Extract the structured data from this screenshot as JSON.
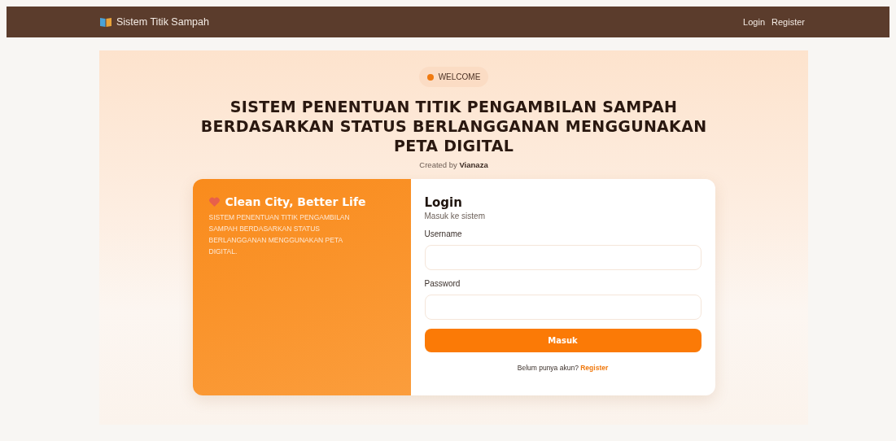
{
  "navbar": {
    "brand": "Sistem Titik Sampah",
    "links": [
      "Login",
      "Register"
    ]
  },
  "hero": {
    "badge": "WELCOME",
    "title": "SISTEM PENENTUAN TITIK PENGAMBILAN SAMPAH BERDASARKAN STATUS BERLANGGANAN MENGGUNAKAN PETA DIGITAL",
    "credit": "Created by **Vianaza**"
  },
  "promo": {
    "heading": "Clean City, Better Life",
    "text": "SISTEM PENENTUAN TITIK PENGAMBILAN SAMPAH BERDASARKAN STATUS BERLANGGANAN MENGGUNAKAN PETA DIGITAL."
  },
  "login": {
    "title": "Login",
    "subtitle": "Masuk ke sistem",
    "fields": [
      {
        "label": "Username"
      },
      {
        "label": "Password"
      }
    ],
    "submit": "Masuk",
    "footer": "Belum punya akun?",
    "footer_link": "Register"
  }
}
